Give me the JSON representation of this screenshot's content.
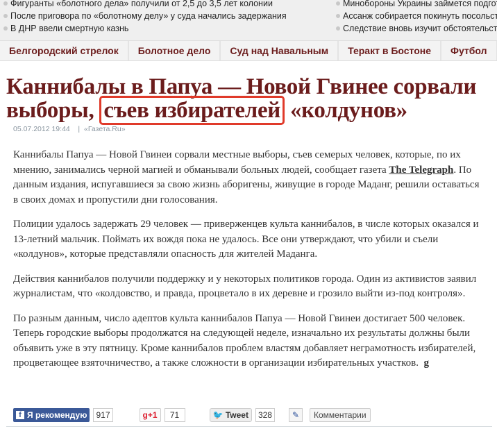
{
  "top_news": {
    "left": [
      "Фигуранты «болотного дела» получили от 2,5 до 3,5 лет колонии",
      "После приговора по «болотному делу» у суда начались задержания",
      "В ДНР ввели смертную казнь"
    ],
    "right": [
      "Минобороны Украины займется подгото",
      "Ассанж собирается покинуть посольств",
      "Следствие вновь изучит обстоятельства"
    ]
  },
  "nav": [
    "Белгородский стрелок",
    "Болотное дело",
    "Суд над Навальным",
    "Теракт в Бостоне",
    "Футбол"
  ],
  "article": {
    "title_before": "Каннибалы в Папуа — Новой Гвинее сорвали выборы, ",
    "title_highlight": "съев избирателей",
    "title_after": " «колдунов»",
    "date": "05.07.2012 19:44",
    "separator": "|",
    "source": "«Газета.Ru»",
    "p1_before": "Каннибалы Папуа — Новой Гвинеи сорвали местные выборы, съев семерых человек, которые, по их мнению, занимались черной магией и обманывали больных людей, сообщает газета ",
    "p1_link": "The Telegraph",
    "p1_after": ". По данным издания, испугавшиеся за свою жизнь аборигены, живущие в городе Маданг, решили оставаться в своих домах и пропустили дни голосования.",
    "p2": "Полиции удалось задержать 29 человек — приверженцев культа каннибалов, в числе которых оказался и 13-летний мальчик. Поймать их вождя пока не удалось. Все они утверждают, что убили и съели «колдунов», которые представляли опасность для жителей Маданга.",
    "p3": "Действия каннибалов получили поддержку и у некоторых политиков города. Один из активистов заявил журналистам, что «колдовство, и правда, процветало в их деревне и грозило выйти из-под контроля».",
    "p4": "По разным данным, число адептов культа каннибалов Папуа — Новой Гвинеи достигает 500 человек. Теперь городские выборы продолжатся на следующей неделе, изначально их результаты должны были объявить уже в эту пятницу. Кроме каннибалов проблем властям добавляет неграмотность избирателей, процветающее взяточничество, а также сложности в организации избирательных участков.",
    "end_mark": "g"
  },
  "share": {
    "fb_label": "Я рекомендую",
    "fb_count": "917",
    "gplus_label": "+1",
    "gplus_count": "71",
    "tweet_label": "Tweet",
    "tweet_count": "328",
    "comments_label": "Комментарии"
  }
}
